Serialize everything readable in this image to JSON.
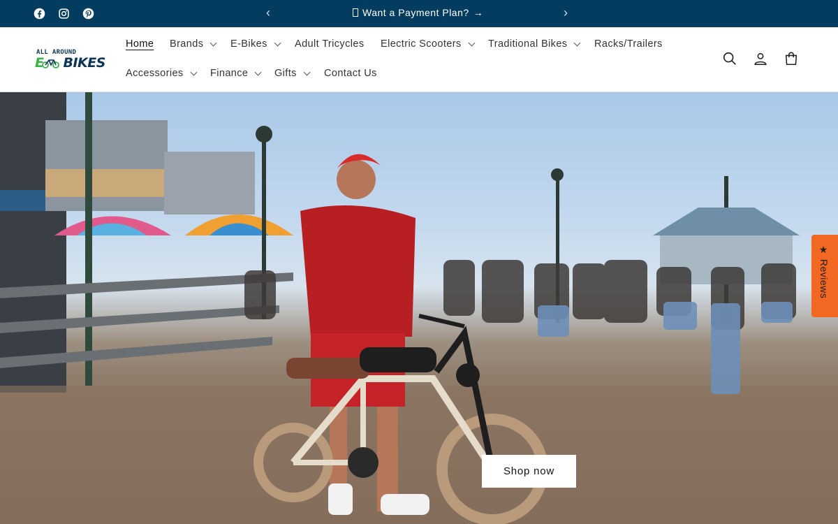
{
  "announcement": {
    "message": "Want a Payment Plan?",
    "arrow_glyph": "→",
    "prev_glyph": "‹",
    "next_glyph": "›"
  },
  "social": [
    "facebook-icon",
    "instagram-icon",
    "pinterest-icon"
  ],
  "logo": {
    "line1": "ALL AROUND",
    "line2_prefix": "E",
    "line2_rest": "BIKES"
  },
  "nav": {
    "items": [
      {
        "label": "Home",
        "dropdown": false,
        "active": true
      },
      {
        "label": "Brands",
        "dropdown": true
      },
      {
        "label": "E-Bikes",
        "dropdown": true
      },
      {
        "label": "Adult Tricycles",
        "dropdown": false
      },
      {
        "label": "Electric Scooters",
        "dropdown": true
      },
      {
        "label": "Traditional Bikes",
        "dropdown": true
      },
      {
        "label": "Racks/Trailers",
        "dropdown": false
      },
      {
        "label": "Accessories",
        "dropdown": true
      },
      {
        "label": "Finance",
        "dropdown": true
      },
      {
        "label": "Gifts",
        "dropdown": true
      },
      {
        "label": "Contact Us",
        "dropdown": false
      }
    ]
  },
  "header_icons": [
    "search-icon",
    "account-icon",
    "cart-icon"
  ],
  "hero": {
    "cta_label": "Shop now"
  },
  "reviews_tab": {
    "label": "★ Reviews"
  },
  "colors": {
    "announcement_bg": "#033c5e",
    "reviews_bg": "#f26722",
    "logo_green": "#3bb14a",
    "logo_navy": "#0d3555"
  }
}
